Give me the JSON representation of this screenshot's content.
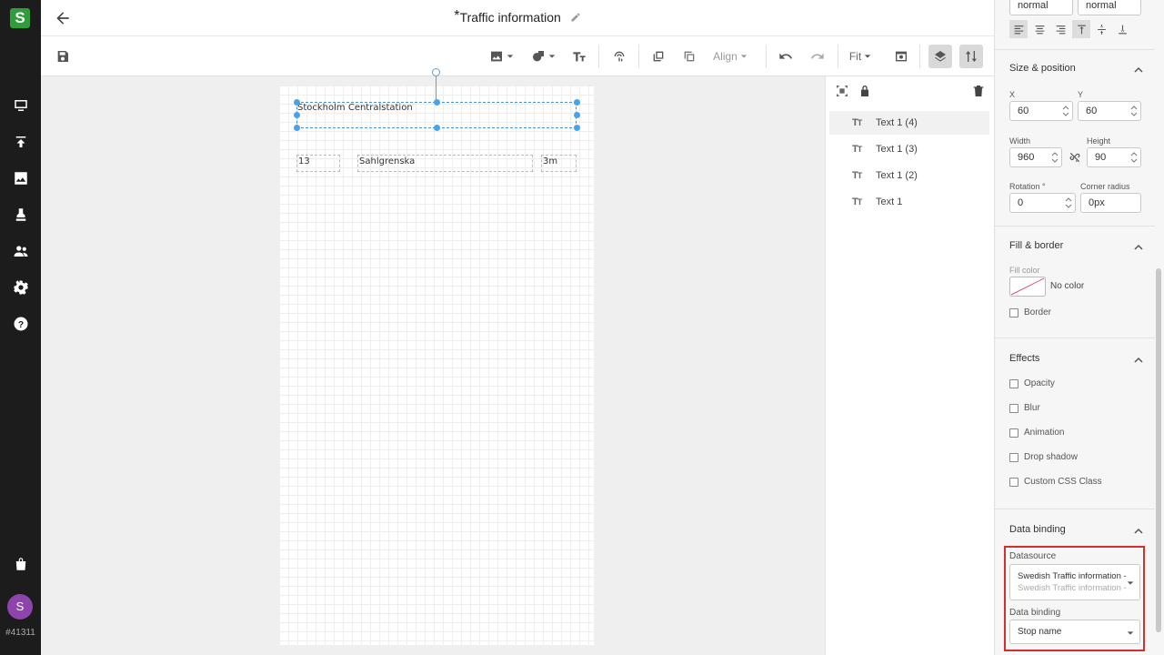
{
  "app": {
    "logo_letter": "S",
    "account_id": "#41311",
    "avatar_letter": "S"
  },
  "header": {
    "unsaved_marker": "*",
    "title": "Traffic information"
  },
  "toolbar": {
    "align_label": "Align",
    "zoom_label": "Fit"
  },
  "canvas": {
    "selected_text": "Stockholm Centralstation",
    "row": [
      "13",
      "Sahlgrenska",
      "3m"
    ]
  },
  "layers": {
    "items": [
      {
        "label": "Text 1 (4)",
        "active": true
      },
      {
        "label": "Text 1 (3)",
        "active": false
      },
      {
        "label": "Text 1 (2)",
        "active": false
      },
      {
        "label": "Text 1",
        "active": false
      }
    ]
  },
  "props": {
    "font_weight": "normal",
    "font_style": "normal",
    "size_position": {
      "title": "Size & position",
      "x_label": "X",
      "x_value": "60",
      "y_label": "Y",
      "y_value": "60",
      "width_label": "Width",
      "width_value": "960",
      "height_label": "Height",
      "height_value": "90",
      "rotation_label": "Rotation °",
      "rotation_value": "0",
      "corner_label": "Corner radius",
      "corner_value": "0px"
    },
    "fill_border": {
      "title": "Fill & border",
      "fill_label": "Fill color",
      "fill_value": "No color",
      "border_label": "Border"
    },
    "effects": {
      "title": "Effects",
      "items": [
        "Opacity",
        "Blur",
        "Animation",
        "Drop shadow",
        "Custom CSS Class"
      ]
    },
    "data_binding": {
      "title": "Data binding",
      "datasource_label": "Datasource",
      "datasource_value": "Swedish Traffic information - ...",
      "datasource_sub": "Swedish Traffic information - ...",
      "binding_label": "Data binding",
      "binding_value": "Stop name"
    }
  },
  "colors": {
    "rail_bg": "#1c1c1c",
    "brand_green": "#2e9e3a",
    "selection_blue": "#4aa3e8",
    "highlight_red": "#d32f2f",
    "avatar_purple": "#8e44ad"
  }
}
